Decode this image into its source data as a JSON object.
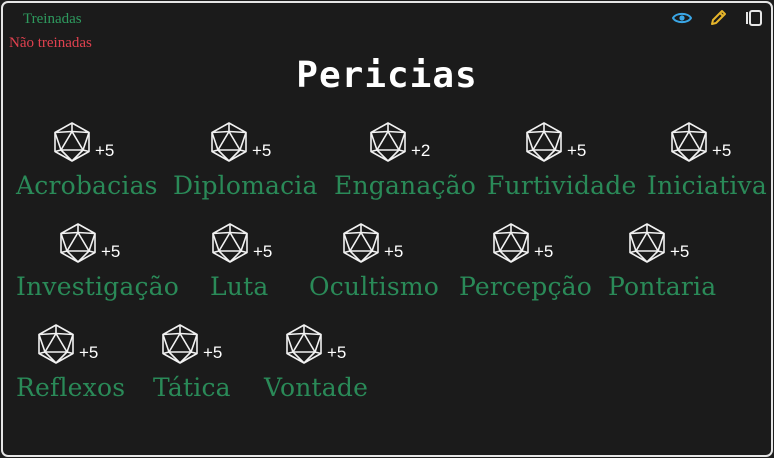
{
  "legend": {
    "trained": "Treinadas",
    "untrained": "Não treinadas"
  },
  "toolbar": [
    {
      "name": "eye-button",
      "icon": "eye-icon",
      "color": "#3aa6e6"
    },
    {
      "name": "edit-button",
      "icon": "pencil-icon",
      "color": "#e6b52a"
    },
    {
      "name": "layout-button",
      "icon": "panel-icon",
      "color": "#e6e6e6"
    }
  ],
  "title": "Pericias",
  "colors": {
    "trained": "#2a8a58",
    "untrained": "#e0414f",
    "bonus": "#ffffff"
  },
  "skills": [
    {
      "name": "Acrobacias",
      "bonus": "+5",
      "trained": true
    },
    {
      "name": "Diplomacia",
      "bonus": "+5",
      "trained": true
    },
    {
      "name": "Enganação",
      "bonus": "+2",
      "trained": true
    },
    {
      "name": "Furtividade",
      "bonus": "+5",
      "trained": true
    },
    {
      "name": "Iniciativa",
      "bonus": "+5",
      "trained": true
    },
    {
      "name": "Investigação",
      "bonus": "+5",
      "trained": true
    },
    {
      "name": "Luta",
      "bonus": "+5",
      "trained": true
    },
    {
      "name": "Ocultismo",
      "bonus": "+5",
      "trained": true
    },
    {
      "name": "Percepção",
      "bonus": "+5",
      "trained": true
    },
    {
      "name": "Pontaria",
      "bonus": "+5",
      "trained": true
    },
    {
      "name": "Reflexos",
      "bonus": "+5",
      "trained": true
    },
    {
      "name": "Tática",
      "bonus": "+5",
      "trained": true
    },
    {
      "name": "Vontade",
      "bonus": "+5",
      "trained": true
    }
  ]
}
